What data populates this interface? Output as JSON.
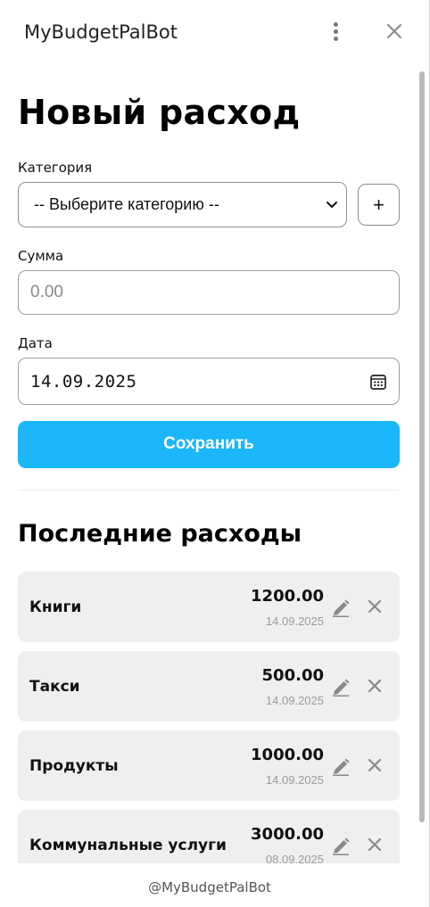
{
  "app": {
    "title": "MyBudgetPalBot"
  },
  "form": {
    "heading": "Новый расход",
    "category_label": "Категория",
    "category_selected": "-- Выберите категорию --",
    "add_category_label": "+",
    "amount_label": "Сумма",
    "amount_placeholder": "0.00",
    "date_label": "Дата",
    "date_value": "14.09.2025",
    "save_label": "Сохранить"
  },
  "recent": {
    "heading": "Последние расходы",
    "items": [
      {
        "category": "Книги",
        "amount": "1200.00",
        "date": "14.09.2025"
      },
      {
        "category": "Такси",
        "amount": "500.00",
        "date": "14.09.2025"
      },
      {
        "category": "Продукты",
        "amount": "1000.00",
        "date": "14.09.2025"
      },
      {
        "category": "Коммунальные услуги",
        "amount": "3000.00",
        "date": "08.09.2025"
      }
    ]
  },
  "footer": {
    "text": "@MyBudgetPalBot"
  },
  "colors": {
    "accent": "#1cb6fa",
    "card_bg": "#efefef",
    "icon_gray": "#8a8a8a"
  },
  "icons": [
    "more-vertical-icon",
    "close-icon",
    "chevron-down-icon",
    "calendar-icon",
    "pencil-icon",
    "delete-x-icon"
  ]
}
